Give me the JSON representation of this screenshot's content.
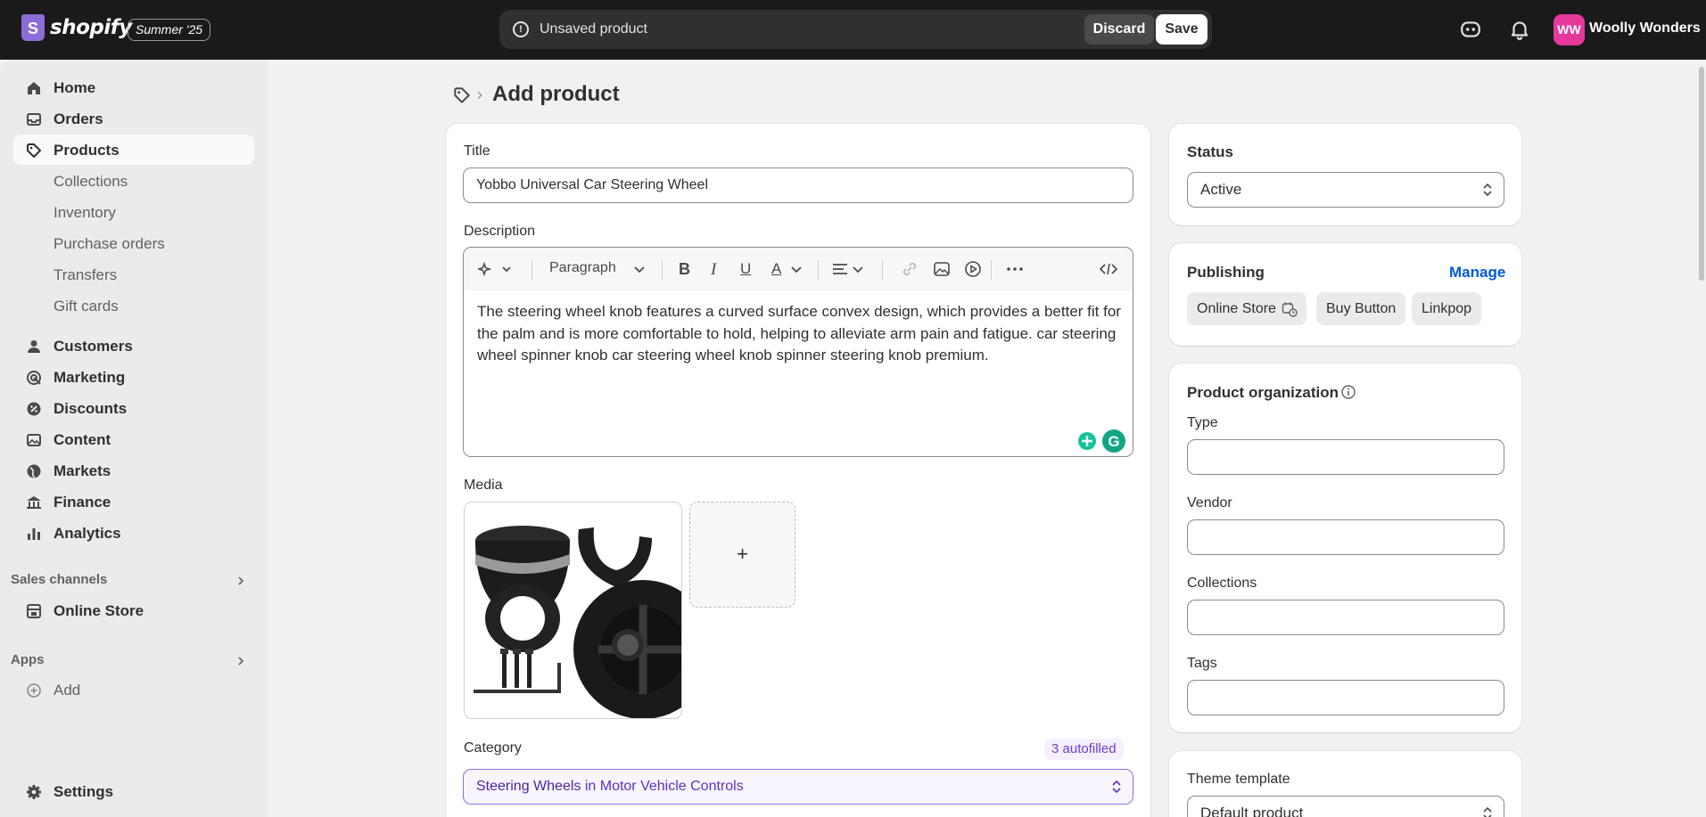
{
  "topbar": {
    "logo_text": "shopify",
    "edition_badge": "Summer '25",
    "unsaved_text": "Unsaved product",
    "discard_label": "Discard",
    "save_label": "Save",
    "avatar_initials": "WW",
    "store_name": "Woolly Wonders"
  },
  "sidebar": {
    "items": [
      {
        "label": "Home",
        "icon": "home-icon"
      },
      {
        "label": "Orders",
        "icon": "inbox-icon"
      },
      {
        "label": "Products",
        "icon": "tag-icon"
      },
      {
        "label": "Collections"
      },
      {
        "label": "Inventory"
      },
      {
        "label": "Purchase orders"
      },
      {
        "label": "Transfers"
      },
      {
        "label": "Gift cards"
      },
      {
        "label": "Customers",
        "icon": "person-icon"
      },
      {
        "label": "Marketing",
        "icon": "target-icon"
      },
      {
        "label": "Discounts",
        "icon": "discount-icon"
      },
      {
        "label": "Content",
        "icon": "image-icon"
      },
      {
        "label": "Markets",
        "icon": "globe-icon"
      },
      {
        "label": "Finance",
        "icon": "bank-icon"
      },
      {
        "label": "Analytics",
        "icon": "bar-chart-icon"
      }
    ],
    "sales_channels_label": "Sales channels",
    "online_store_label": "Online Store",
    "apps_label": "Apps",
    "add_label": "Add",
    "settings_label": "Settings"
  },
  "main": {
    "page_title": "Add product",
    "title_label": "Title",
    "title_value": "Yobbo Universal Car Steering Wheel",
    "description_label": "Description",
    "paragraph_label": "Paragraph",
    "description_text": "The steering wheel knob features a curved surface convex design, which provides a better fit for the palm and is more comfortable to hold, helping to alleviate arm pain and fatigue. car steering wheel spinner knob car steering wheel knob spinner steering knob premium.",
    "media_label": "Media",
    "media_add": "+",
    "category_label": "Category",
    "autofill_badge": "3 autofilled",
    "category_value_strong": "Steering Wheels",
    "category_value_rest": " in Motor Vehicle Controls"
  },
  "right": {
    "status_title": "Status",
    "status_value": "Active",
    "publishing_title": "Publishing",
    "manage_label": "Manage",
    "channels": [
      "Online Store",
      "Buy Button",
      "Linkpop"
    ],
    "org_title": "Product organization",
    "type_label": "Type",
    "vendor_label": "Vendor",
    "collections_label": "Collections",
    "tags_label": "Tags",
    "theme_title": "Theme template",
    "theme_value": "Default product"
  }
}
